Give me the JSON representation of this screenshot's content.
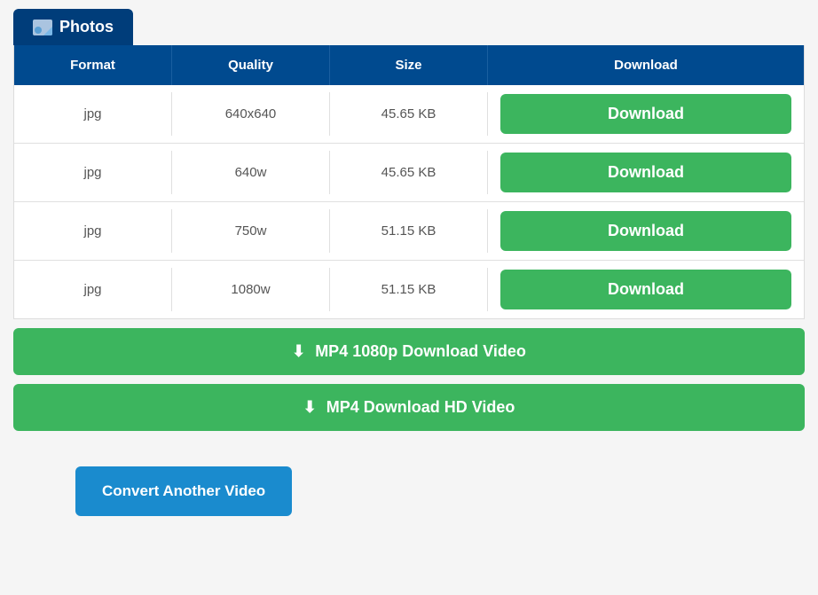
{
  "tab": {
    "label": "Photos",
    "icon": "photos-icon"
  },
  "table": {
    "headers": {
      "format": "Format",
      "quality": "Quality",
      "size": "Size",
      "download": "Download"
    },
    "rows": [
      {
        "format": "jpg",
        "quality": "640x640",
        "size": "45.65 KB",
        "download_label": "Download"
      },
      {
        "format": "jpg",
        "quality": "640w",
        "size": "45.65 KB",
        "download_label": "Download"
      },
      {
        "format": "jpg",
        "quality": "750w",
        "size": "51.15 KB",
        "download_label": "Download"
      },
      {
        "format": "jpg",
        "quality": "1080w",
        "size": "51.15 KB",
        "download_label": "Download"
      }
    ]
  },
  "big_buttons": {
    "mp4_1080p": "MP4 1080p Download Video",
    "mp4_hd": "MP4 Download HD Video"
  },
  "convert_button": {
    "label": "Convert Another Video"
  }
}
